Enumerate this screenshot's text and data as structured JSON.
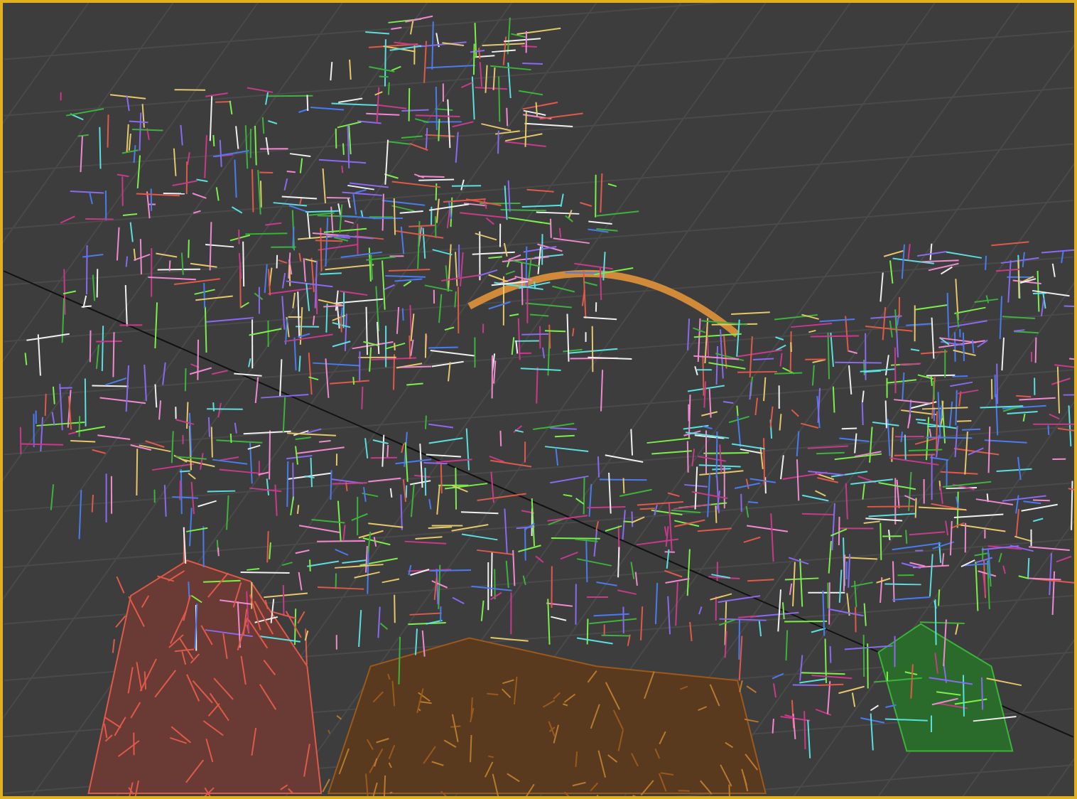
{
  "viewport": {
    "active": true
  }
}
